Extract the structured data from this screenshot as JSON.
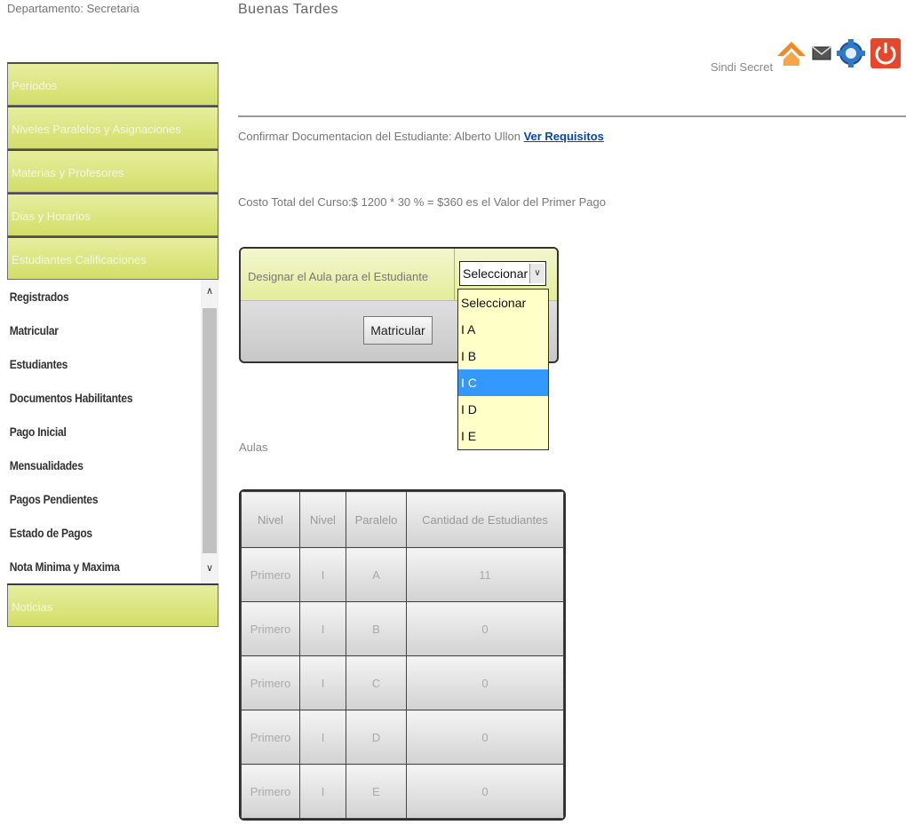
{
  "header": {
    "department": "Departamento: Secretaria",
    "greeting": "Buenas Tardes",
    "user": "Sindi Secret",
    "icons": [
      "home-icon",
      "mail-icon",
      "settings-gear-icon",
      "power-icon"
    ]
  },
  "sidebar": {
    "items": [
      {
        "label": "Periodos"
      },
      {
        "label": "Niveles Paralelos y Asignaciones"
      },
      {
        "label": "Materias y Profesores"
      },
      {
        "label": "Dias y Horarios"
      },
      {
        "label": "Estudiantes Calificaciones"
      }
    ],
    "submenu": [
      {
        "label": "Registrados"
      },
      {
        "label": "Matricular"
      },
      {
        "label": "Estudiantes"
      },
      {
        "label": "Documentos Habilitantes"
      },
      {
        "label": "Pago Inicial"
      },
      {
        "label": "Mensualidades"
      },
      {
        "label": "Pagos Pendientes"
      },
      {
        "label": "Estado de Pagos"
      },
      {
        "label": "Nota Minima y Maxima"
      }
    ],
    "last_item": {
      "label": "Noticias"
    },
    "scroll_up": "∧",
    "scroll_down": "∨"
  },
  "main": {
    "confirm_text": "Confirmar Documentacion del Estudiante: Alberto Ullon ",
    "confirm_link": "Ver Requisitos",
    "cost_text": "Costo Total del Curso:$ 1200 * 30 % = $360 es el Valor del Primer Pago",
    "assign_label": "Designar el Aula para el Estudiante",
    "select_value": "Seleccionar",
    "select_caret": "∨",
    "select_options": [
      "Seleccionar",
      "I A",
      "I B",
      "I C",
      "I D",
      "I E"
    ],
    "highlighted_option": "I C",
    "enroll_button": "Matricular",
    "aulas_label": "Aulas"
  },
  "table": {
    "headers": [
      "Nivel",
      "Nivel",
      "Paralelo",
      "Cantidad de Estudiantes"
    ],
    "rows": [
      [
        "Primero",
        "I",
        "A",
        "11"
      ],
      [
        "Primero",
        "I",
        "B",
        "0"
      ],
      [
        "Primero",
        "I",
        "C",
        "0"
      ],
      [
        "Primero",
        "I",
        "D",
        "0"
      ],
      [
        "Primero",
        "I",
        "E",
        "0"
      ]
    ]
  }
}
